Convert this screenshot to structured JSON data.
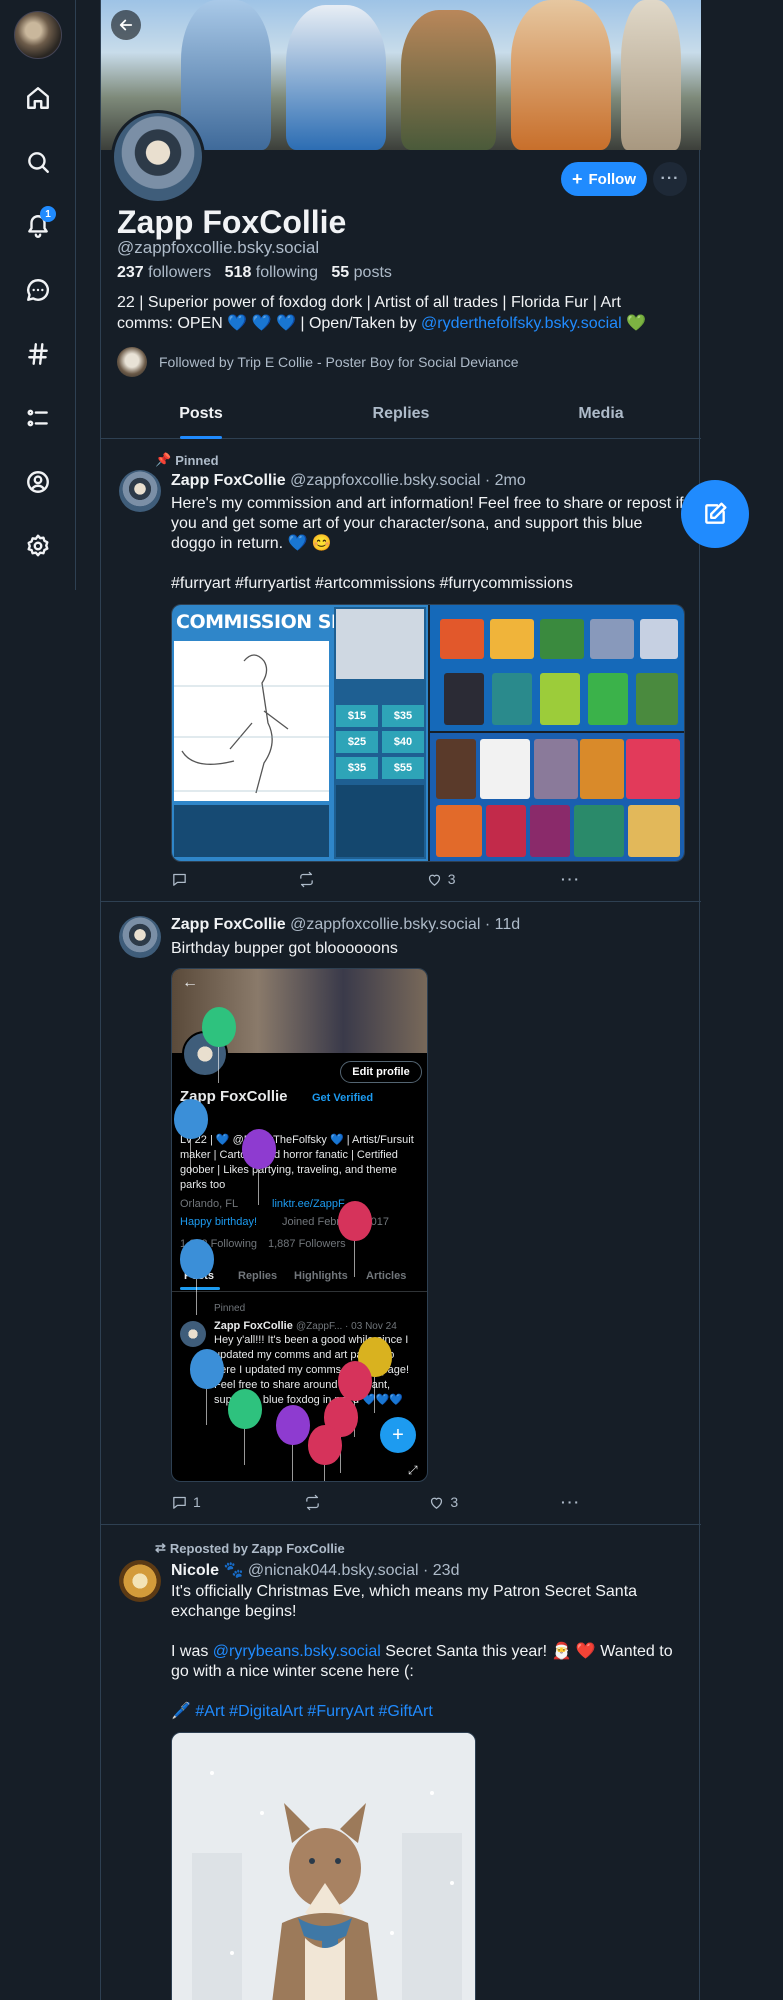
{
  "nav": {
    "items": [
      {
        "name": "home"
      },
      {
        "name": "search"
      },
      {
        "name": "notifications",
        "badge": "1"
      },
      {
        "name": "chat"
      },
      {
        "name": "feeds"
      },
      {
        "name": "lists"
      },
      {
        "name": "profile"
      },
      {
        "name": "settings"
      }
    ]
  },
  "profile": {
    "display_name": "Zapp FoxCollie",
    "handle": "@zappfoxcollie.bsky.social",
    "followers_count": "237",
    "followers_label": "followers",
    "following_count": "518",
    "following_label": "following",
    "posts_count": "55",
    "posts_label": "posts",
    "bio_text": "22 | Superior power of foxdog dork | Artist of all trades | Florida Fur | Art comms: OPEN",
    "bio_hearts": "💙 💙 💙",
    "bio_open_taken": " | Open/Taken by ",
    "bio_link": "@ryderthefolfsky.bsky.social",
    "bio_green_heart": "💚",
    "followed_by": "Followed by Trip E Collie - Poster Boy for Social Deviance",
    "follow_label": "Follow",
    "more_label": "···"
  },
  "tabs": [
    {
      "label": "Posts",
      "active": true
    },
    {
      "label": "Replies",
      "active": false
    },
    {
      "label": "Media",
      "active": false
    }
  ],
  "posts": [
    {
      "pinned_label": "Pinned",
      "author": "Zapp FoxCollie",
      "handle": "@zappfoxcollie.bsky.social",
      "time": "· 2mo",
      "text": "Here's my commission and art information! Feel free to share or repost if you and get some art of your character/sona, and support this blue doggo in return. 💙 😊",
      "tags": "#furryart #furryartist #artcommissions #furrycommissions",
      "image_title": "COMMISSION SHEET",
      "prices": [
        "$15",
        "$35",
        "$25",
        "$40",
        "$35",
        "$55"
      ],
      "replies": "",
      "reposts": "",
      "likes": "3"
    },
    {
      "author": "Zapp FoxCollie",
      "handle": "@zappfoxcollie.bsky.social",
      "time": "· 11d",
      "text": "Birthday bupper got bloooooons",
      "screenshot": {
        "name": "Zapp FoxCollie",
        "verified": "Get Verified",
        "edit": "Edit profile",
        "bio": "Lv 22 | 💙 @RyderTheFolfsky 💙 | Artist/Fursuit maker | Cartoon and horror fanatic | Certified goober | Likes partying, traveling, and theme parks too",
        "location": "Orlando, FL",
        "link": "linktr.ee/ZappF...",
        "birthday": "Happy birthday!",
        "joined": "Joined February 2017",
        "following": "1,052 Following",
        "followers": "1,887 Followers",
        "tabs": [
          "Posts",
          "Replies",
          "Highlights",
          "Articles"
        ],
        "pinned": "Pinned",
        "post_author": "Zapp FoxCollie",
        "post_handle": "@ZappF... · 03 Nov 24",
        "post_text": "Hey y'all!!! It's been a good while since I updated my comms and art page. So here I updated my comms and art page! Feel free to share around if ya want, support a blue foxdog in need 💙💙💙"
      },
      "replies": "1",
      "reposts": "",
      "likes": "3"
    },
    {
      "repost_label": "Reposted by Zapp FoxCollie",
      "author": "Nicole 🐾",
      "handle": "@nicnak044.bsky.social",
      "time": "· 23d",
      "text1": "It's officially Christmas Eve, which means my Patron Secret Santa exchange begins!",
      "text2_pre": "I was ",
      "text2_link": "@ryrybeans.bsky.social",
      "text2_post": " Secret Santa this year! 🎅 ❤️ Wanted to go with a nice winter scene here (:",
      "tags_prefix": "🖊️",
      "tags": "#Art #DigitalArt #FurryArt #GiftArt"
    }
  ],
  "colors": {
    "background": "#161e27",
    "accent": "#208bfe",
    "muted": "#aebbc9",
    "border": "#2e4052"
  }
}
